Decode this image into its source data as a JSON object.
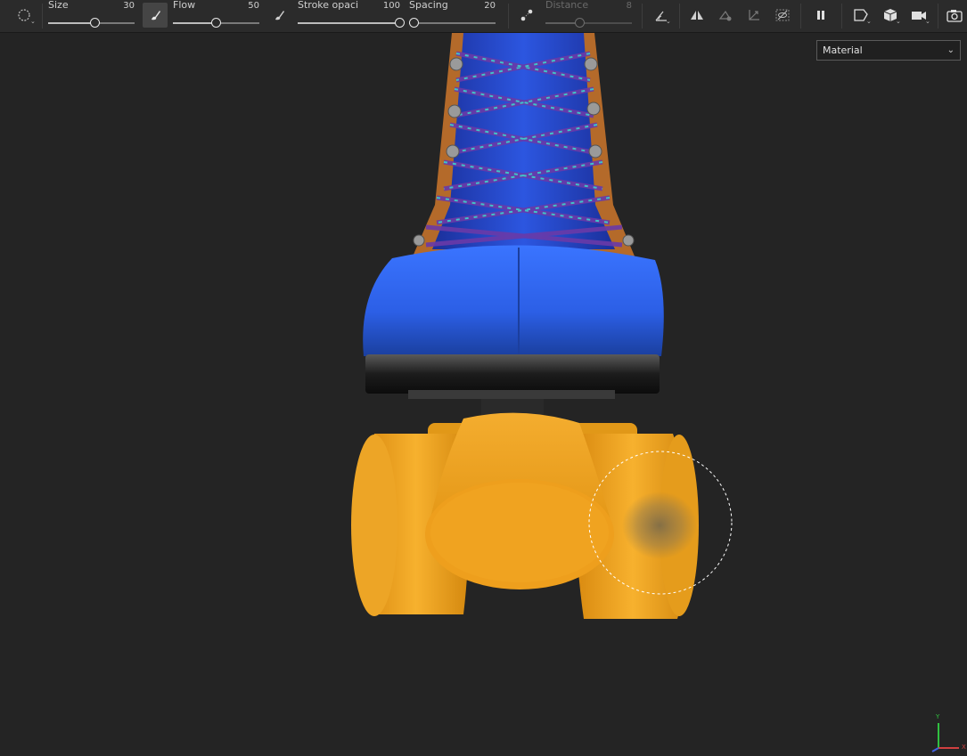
{
  "toolbar": {
    "size": {
      "label": "Size",
      "value": "30",
      "fraction": 0.55
    },
    "flow": {
      "label": "Flow",
      "value": "50",
      "fraction": 0.5
    },
    "stroke_opacity": {
      "label": "Stroke opaci",
      "value": "100",
      "fraction": 1.0
    },
    "spacing": {
      "label": "Spacing",
      "value": "20",
      "fraction": 0.06
    },
    "distance": {
      "label": "Distance",
      "value": "8",
      "fraction": 0.4,
      "disabled": true
    }
  },
  "icons": {
    "brush_shape": "circle-brush-icon",
    "brush_mode": "brush-icon",
    "alignment": "alignment-icon",
    "lazy_mouse": "lazy-mouse-icon",
    "symmetry": "symmetry-icon",
    "fill_projection": "fill-icon",
    "transform": "transform-icon",
    "occlusion": "occlusion-icon",
    "pause": "pause-icon",
    "view_mode": "view-plane-icon",
    "cube": "cube-icon",
    "camera": "camera-icon",
    "screenshot": "screenshot-icon"
  },
  "viewport": {
    "channel_dropdown": {
      "value": "Material"
    },
    "axis": {
      "y": "Y",
      "x": "X"
    }
  },
  "colors": {
    "toolbar_bg": "#2b2b2b",
    "viewport_bg": "#242424",
    "boot_blue": "#2f62ea",
    "wheel_yellow": "#f2a623"
  }
}
